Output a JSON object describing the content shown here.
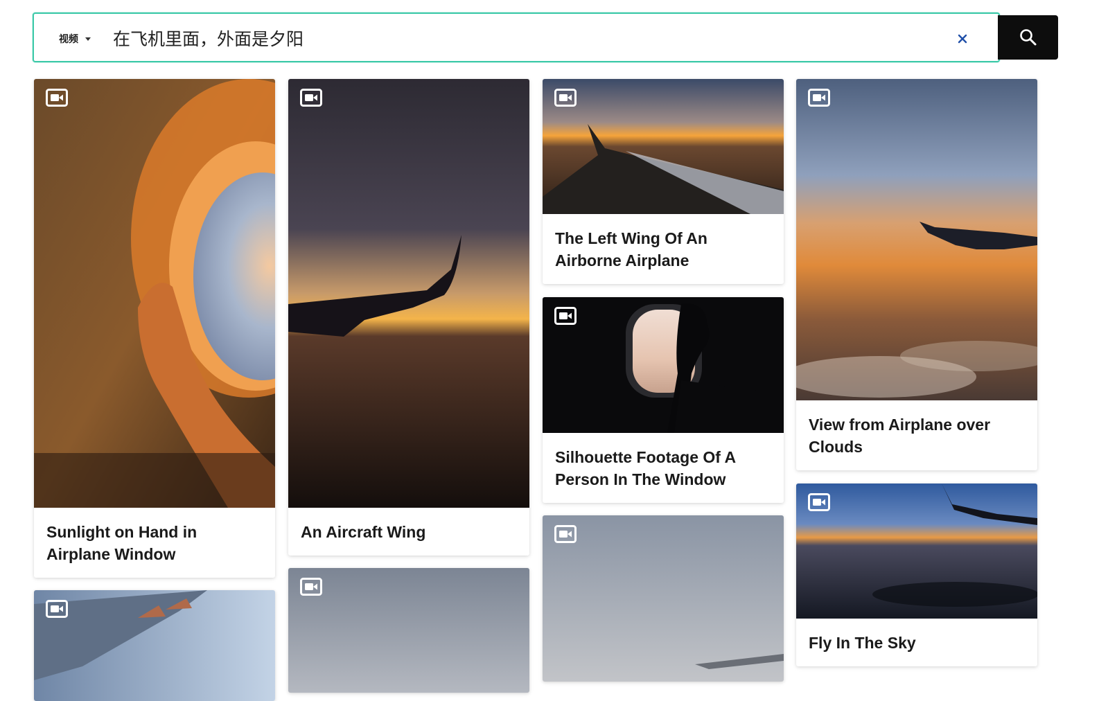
{
  "search": {
    "type_label": "视频",
    "query": "在飞机里面，外面是夕阳",
    "clear_label": "×"
  },
  "results": [
    {
      "title": "Sunlight on Hand in Airplane Window",
      "media": "video-icon"
    },
    {
      "title": "An Aircraft Wing",
      "media": "video-icon"
    },
    {
      "title": "The Left Wing Of An Airborne Airplane",
      "media": "video-icon"
    },
    {
      "title": "View from Airplane over Clouds",
      "media": "video-icon"
    },
    {
      "title": "Silhouette Footage Of A Person In The Window",
      "media": "video-icon"
    },
    {
      "title": "Fly In The Sky",
      "media": "video-icon"
    },
    {
      "title": "",
      "media": "video-icon"
    },
    {
      "title": "",
      "media": "video-icon"
    },
    {
      "title": "",
      "media": "video-icon"
    }
  ],
  "colors": {
    "accent": "#3cc9a8",
    "search_button": "#0d0d0d"
  }
}
